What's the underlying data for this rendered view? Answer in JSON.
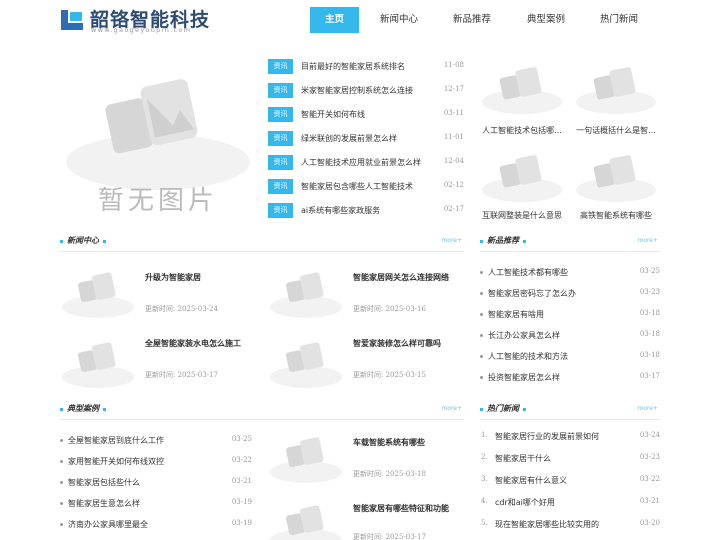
{
  "brand": {
    "name": "韶铬智能科技",
    "domain": "www.gaogeyoupin.com",
    "accent": "#34b7ea"
  },
  "nav": [
    {
      "label": "主页",
      "active": true
    },
    {
      "label": "新闻中心",
      "active": false
    },
    {
      "label": "新品推荐",
      "active": false
    },
    {
      "label": "典型案例",
      "active": false
    },
    {
      "label": "热门新闻",
      "active": false
    }
  ],
  "hero": {
    "placeholder_text": "暂无图片"
  },
  "top_news": [
    {
      "tag": "资讯",
      "title": "目前最好的智能家居系统排名",
      "date": "11-08"
    },
    {
      "tag": "资讯",
      "title": "米家智能家居控制系统怎么连接",
      "date": "12-17"
    },
    {
      "tag": "资讯",
      "title": "智能开关如何布线",
      "date": "03-11"
    },
    {
      "tag": "资讯",
      "title": "绿米联创的发展前景怎么样",
      "date": "11-01"
    },
    {
      "tag": "资讯",
      "title": "人工智能技术应用就业前景怎么样",
      "date": "12-04"
    },
    {
      "tag": "资讯",
      "title": "智能家居包含哪些人工智能技术",
      "date": "02-12"
    },
    {
      "tag": "资讯",
      "title": "ai系统有哪些家政服务",
      "date": "02-17"
    }
  ],
  "side_pics": [
    {
      "caption": "人工智能技术包括哪..."
    },
    {
      "caption": "一句话概括什么是智..."
    },
    {
      "caption": "互联网整装是什么意思"
    },
    {
      "caption": "高铁智能系统有哪些"
    }
  ],
  "news_center": {
    "title": "新闻中心",
    "more": "more+",
    "time_label": "更新时间:",
    "items": [
      {
        "title": "升级为智能家居",
        "date": "2025-03-24"
      },
      {
        "title": "智能家居网关怎么连接网络",
        "date": "2025-03-16"
      },
      {
        "title": "全屋智能家装水电怎么施工",
        "date": "2025-03-17"
      },
      {
        "title": "智爱家装修怎么样可靠吗",
        "date": "2025-03-15"
      }
    ]
  },
  "new_products": {
    "title": "新品推荐",
    "more": "more+",
    "items": [
      {
        "title": "人工智能技术都有哪些",
        "date": "03-25"
      },
      {
        "title": "智能家居密码忘了怎么办",
        "date": "03-23"
      },
      {
        "title": "智能家居有啥用",
        "date": "03-18"
      },
      {
        "title": "长江办公家具怎么样",
        "date": "03-18"
      },
      {
        "title": "人工智能的技术和方法",
        "date": "03-18"
      },
      {
        "title": "投资智能家居怎么样",
        "date": "03-17"
      }
    ]
  },
  "cases": {
    "title": "典型案例",
    "more": "more+",
    "list": [
      {
        "title": "全屋智能家居到底什么工作",
        "date": "03-25"
      },
      {
        "title": "家用智能开关如何布线双控",
        "date": "03-22"
      },
      {
        "title": "智能家居包括些什么",
        "date": "03-21"
      },
      {
        "title": "智能家居生意怎么样",
        "date": "03-19"
      },
      {
        "title": "济南办公家具哪里最全",
        "date": "03-19"
      }
    ],
    "cards": [
      {
        "title": "车载智能系统有哪些",
        "date": "2025-03-18"
      },
      {
        "title": "智能家居有哪些特征和功能",
        "date": "2025-03-17"
      }
    ]
  },
  "hot_news": {
    "title": "热门新闻",
    "more": "more+",
    "items": [
      {
        "num": "1.",
        "title": "智能家居行业的发展前景如何",
        "date": "03-24"
      },
      {
        "num": "2.",
        "title": "智能家居干什么",
        "date": "03-23"
      },
      {
        "num": "3.",
        "title": "智能家居有什么意义",
        "date": "03-22"
      },
      {
        "num": "4.",
        "title": "cdr和ai哪个好用",
        "date": "03-21"
      },
      {
        "num": "5.",
        "title": "现在智能家居哪些比较实用的",
        "date": "03-20"
      }
    ]
  }
}
